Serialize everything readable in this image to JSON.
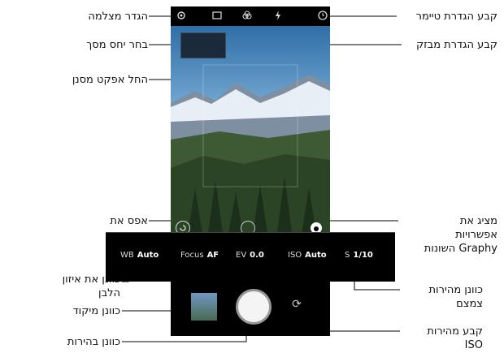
{
  "annotations": {
    "camera_settings": "הגדר מצלמה",
    "aspect_ratio": "בחר יחס מסך",
    "filter_effect": "החל אפקט מסנן",
    "timer": "קבע הגדרת טיימר",
    "flash": "קבע הגדרת מבזק",
    "reset": "אפס את\nההגדרות",
    "graphy": "מציג את\nאפשרויות\nGraphy השונות",
    "white_balance": "כוונן את איזון\nהלבן",
    "focus": "כוונן מיקוד",
    "brightness": "כוונן בהירות",
    "shutter_speed": "כוונן מהירות\nצמצם",
    "iso": "קבע מהירות\nISO"
  },
  "settings_bar": {
    "wb_label": "WB",
    "wb_value": "Auto",
    "focus_label": "Focus",
    "focus_value": "AF",
    "ev_label": "EV",
    "ev_value": "0.0",
    "iso_label": "ISO",
    "iso_value": "Auto",
    "s_label": "S",
    "s_value": "1/10"
  },
  "icons": {
    "settings": "gear-icon",
    "aspect": "aspect-ratio-icon",
    "filter": "filter-icon",
    "flash": "flash-icon",
    "timer": "timer-icon",
    "reset": "reset-icon",
    "graphy": "graphy-icon",
    "switch": "switch-camera-icon"
  },
  "colors": {
    "line": "#000000",
    "phone_bg": "#000000"
  }
}
